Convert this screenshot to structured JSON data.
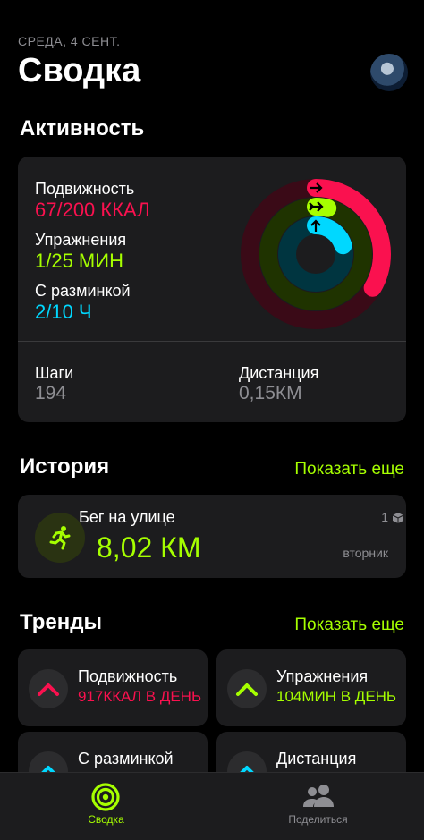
{
  "header": {
    "date": "СРЕДА, 4 СЕНТ.",
    "title": "Сводка"
  },
  "activity": {
    "section_title": "Активность",
    "move": {
      "label": "Подвижность",
      "value": "67/200 ККАЛ",
      "progress": 0.335
    },
    "exercise": {
      "label": "Упражнения",
      "value": "1/25 МИН",
      "progress": 0.04
    },
    "stand": {
      "label": "С разминкой",
      "value": "2/10 Ч",
      "progress": 0.2
    },
    "steps": {
      "label": "Шаги",
      "value": "194"
    },
    "distance": {
      "label": "Дистанция",
      "value": "0,15КМ"
    }
  },
  "history": {
    "section_title": "История",
    "show_more": "Показать еще",
    "workout": {
      "name": "Бег на улице",
      "distance": "8,02 КМ",
      "count": "1",
      "day": "вторник"
    }
  },
  "trends": {
    "section_title": "Тренды",
    "show_more": "Показать еще",
    "items": [
      {
        "name": "Подвижность",
        "value": "917ККАЛ В ДЕНЬ"
      },
      {
        "name": "Упражнения",
        "value": "104МИН В ДЕНЬ"
      },
      {
        "name": "С разминкой",
        "value": ""
      },
      {
        "name": "Дистанция",
        "value": ""
      }
    ]
  },
  "tabbar": {
    "summary": "Сводка",
    "sharing": "Поделиться"
  },
  "colors": {
    "move": "#fa114f",
    "exercise": "#a6ff00",
    "stand": "#00d8ff",
    "card": "#1c1c1e"
  }
}
